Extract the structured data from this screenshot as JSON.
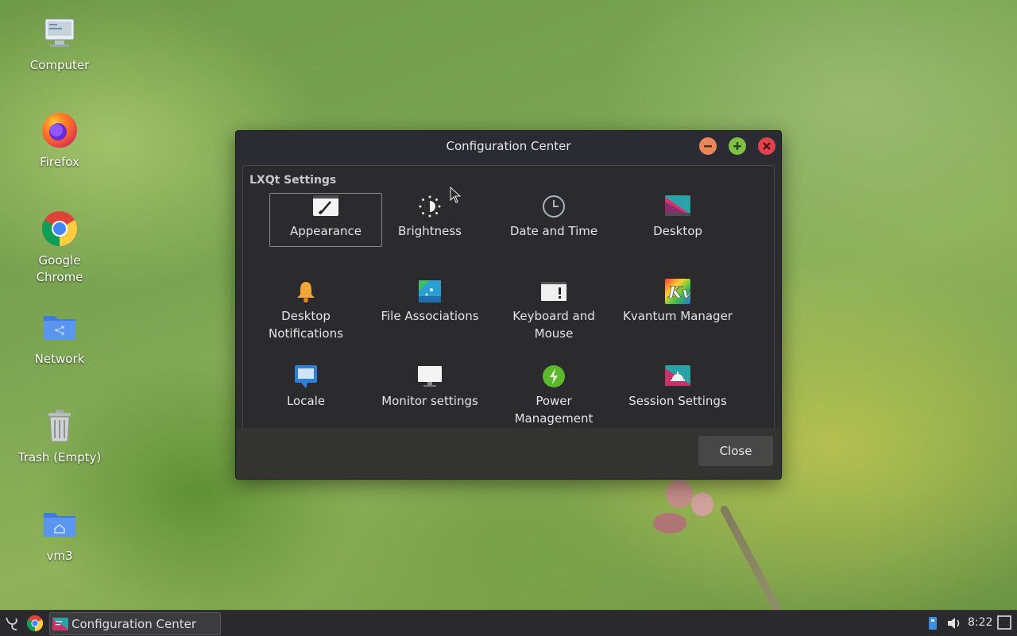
{
  "desktop": {
    "icons": [
      {
        "label": "Computer"
      },
      {
        "label": "Firefox"
      },
      {
        "label": "Google Chrome"
      },
      {
        "label": "Network"
      },
      {
        "label": "Trash (Empty)"
      },
      {
        "label": "vm3"
      }
    ]
  },
  "window": {
    "title": "Configuration Center",
    "group_label": "LXQt Settings",
    "items": [
      {
        "label": "Appearance",
        "icon": "appearance-icon",
        "selected": true
      },
      {
        "label": "Brightness",
        "icon": "brightness-icon"
      },
      {
        "label": "Date and Time",
        "icon": "clock-icon"
      },
      {
        "label": "Desktop",
        "icon": "desktop-icon"
      },
      {
        "label": "Desktop Notifications",
        "icon": "bell-icon"
      },
      {
        "label": "File Associations",
        "icon": "file-associations-icon"
      },
      {
        "label": "Keyboard and Mouse",
        "icon": "keyboard-icon"
      },
      {
        "label": "Kvantum Manager",
        "icon": "kvantum-icon"
      },
      {
        "label": "Locale",
        "icon": "locale-icon"
      },
      {
        "label": "Monitor settings",
        "icon": "monitor-icon"
      },
      {
        "label": "Power Management",
        "icon": "power-icon"
      },
      {
        "label": "Session Settings",
        "icon": "session-icon"
      }
    ],
    "close_label": "Close"
  },
  "taskbar": {
    "task_label": "Configuration Center",
    "clock": "8:22"
  },
  "colors": {
    "minimize": "#e8875a",
    "maximize": "#7dc243",
    "close": "#e0434a"
  }
}
